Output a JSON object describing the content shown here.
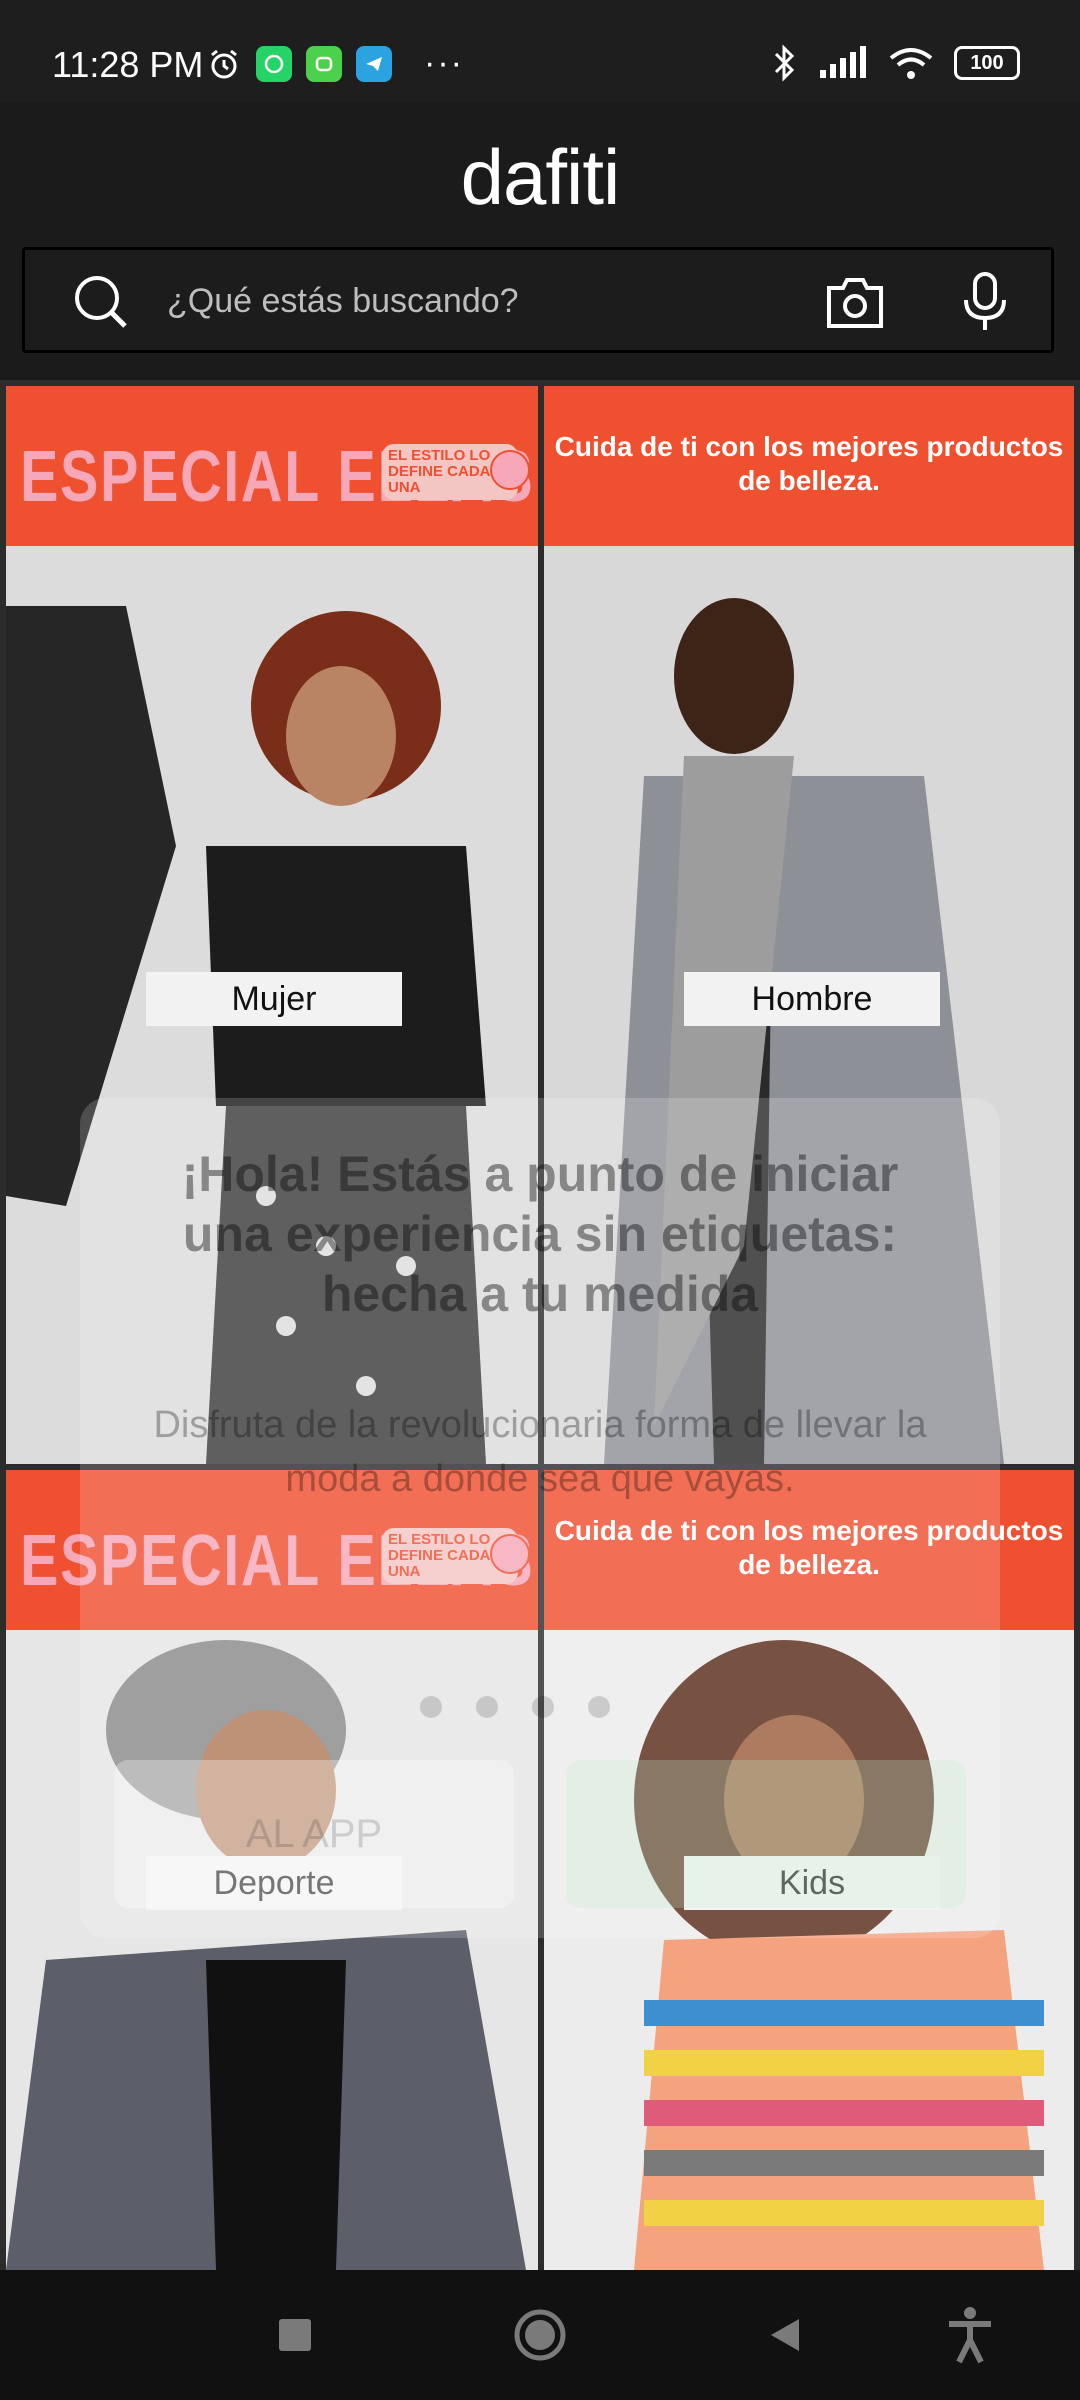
{
  "status_bar": {
    "time": "11:28 PM",
    "more": "···",
    "battery": "100",
    "icons_left": [
      "alarm-icon",
      "whatsapp-icon",
      "android-icon",
      "telegram-icon"
    ],
    "icons_right": [
      "bluetooth-icon",
      "signal-icon",
      "wifi-icon",
      "battery-icon"
    ]
  },
  "header": {
    "logo": "dafiti",
    "search": {
      "placeholder": "¿Qué estás buscando?"
    }
  },
  "tiles": [
    {
      "banner_title": "ESPECIAL ELLAS",
      "banner_tag": "EL ESTILO LO DEFINE CADA UNA",
      "label": "Mujer"
    },
    {
      "banner_text": "Cuida de ti con los mejores productos de belleza.",
      "label": "Hombre"
    },
    {
      "banner_title": "ESPECIAL ELLAS",
      "banner_tag": "EL ESTILO LO DEFINE CADA UNA",
      "label": "Deporte"
    },
    {
      "banner_text": "Cuida de ti con los mejores productos de belleza.",
      "label": "Kids"
    }
  ],
  "popup": {
    "title": "¡Hola! Estás a punto de iniciar una experiencia sin etiquetas: hecha a tu medida",
    "subtitle": "Disfruta de la revolucionaria forma de llevar la moda a donde sea que vayas.",
    "button_left": "AL APP"
  },
  "nav": [
    "recents-icon",
    "home-icon",
    "back-icon",
    "accessibility-icon"
  ],
  "colors": {
    "banner": "#ef5030",
    "banner_pink": "#f7a8b8",
    "background": "#1b1b1b"
  }
}
